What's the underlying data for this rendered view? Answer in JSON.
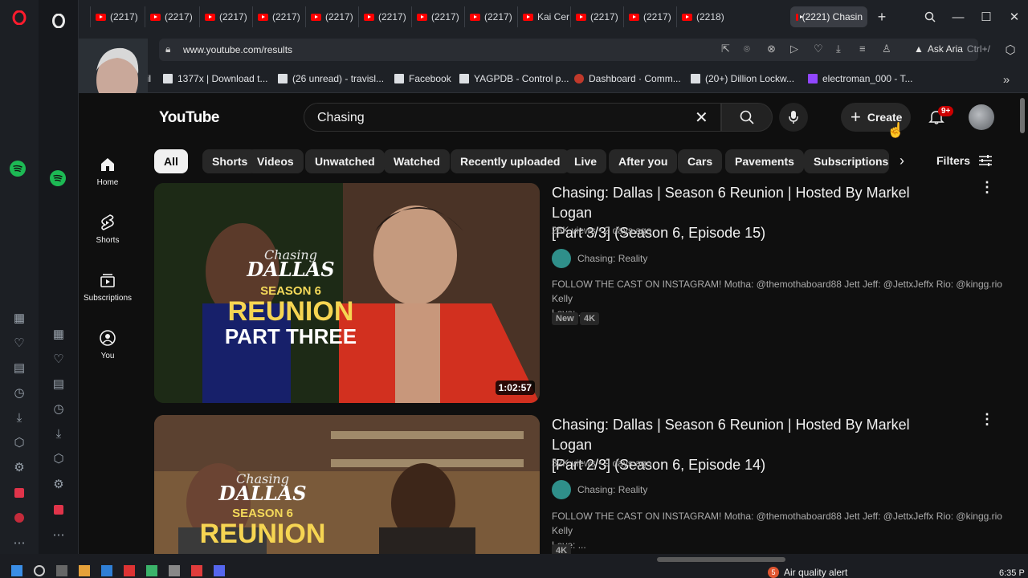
{
  "browser": {
    "tabs": [
      "(2217)",
      "(2217)",
      "(2217)",
      "(2217)",
      "(2217)",
      "(2217)",
      "(2217)",
      "(2217)",
      "Kai Cer",
      "(2217)",
      "(2217)",
      "(2218)",
      "(2221) Chasin"
    ],
    "url": "www.youtube.com/results",
    "aria_label": "Ask Aria",
    "aria_shortcut": "Ctrl+/",
    "bookmarks": [
      "ail",
      "1377x | Download t...",
      "(26 unread) - travisl...",
      "Facebook",
      "YAGPDB - Control p...",
      "Dashboard · Comm...",
      "(20+) Dillion Lockw...",
      "electroman_000 - T..."
    ]
  },
  "youtube": {
    "logo_text": "YouTube",
    "search_value": "Chasing",
    "create_label": "Create",
    "notif_badge": "9+",
    "nav": [
      {
        "label": "Home"
      },
      {
        "label": "Shorts"
      },
      {
        "label": "Subscriptions"
      },
      {
        "label": "You"
      }
    ],
    "chips": [
      "All",
      "Shorts",
      "Videos",
      "Unwatched",
      "Watched",
      "Recently uploaded",
      "Live",
      "After you",
      "Cars",
      "Pavements",
      "Subscriptions"
    ],
    "filters_label": "Filters",
    "videos": [
      {
        "title_line1": "Chasing: Dallas | Season 6 Reunion | Hosted By Markel Logan",
        "title_line2": "[Part 3/3] (Season 6, Episode 15)",
        "meta": "25K views • 2 days ago",
        "channel": "Chasing: Reality",
        "desc_line1": "FOLLOW THE CAST ON INSTAGRAM! Motha: @themothaboard88 Jett Jeff: @JettxJeffx Rio: @kingg.rio Kelly",
        "desc_line2": "Love: ...",
        "badges": [
          "New",
          "4K"
        ],
        "duration": "1:02:57",
        "thumb_text": [
          "Chasing",
          "DALLAS",
          "SEASON 6",
          "REUNION",
          "PART THREE"
        ]
      },
      {
        "title_line1": "Chasing: Dallas | Season 6 Reunion | Hosted By Markel Logan",
        "title_line2": "[Part 2/3] (Season 6, Episode 14)",
        "meta": "32K views • 9 days ago",
        "channel": "Chasing: Reality",
        "desc_line1": "FOLLOW THE CAST ON INSTAGRAM! Motha: @themothaboard88 Jett Jeff: @JettxJeffx Rio: @kingg.rio Kelly",
        "desc_line2": "Love: ...",
        "badges": [
          "4K"
        ],
        "thumb_text": [
          "Chasing",
          "DALLAS",
          "SEASON 6",
          "REUNION"
        ]
      }
    ]
  },
  "taskbar": {
    "alert_count": "5",
    "alert_text": "Air quality alert",
    "time": "6:35 P"
  },
  "colors": {
    "yt_red": "#ff0000",
    "bg": "#0f0f0f",
    "chip": "#272727",
    "spotify": "#1db954",
    "opera_red": "#ff1b2d"
  }
}
